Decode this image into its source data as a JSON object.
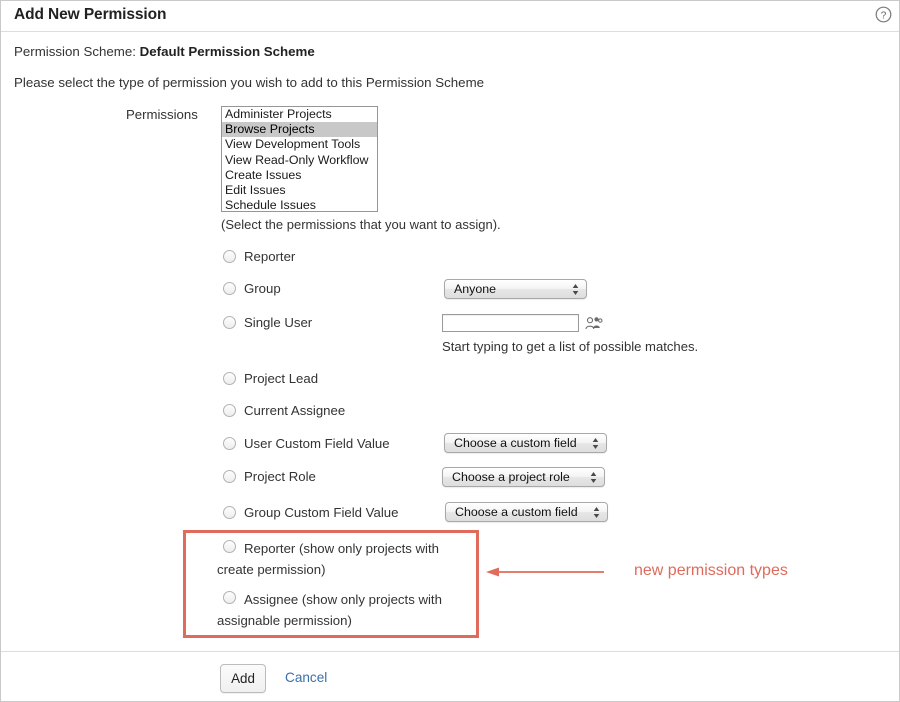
{
  "header": {
    "title": "Add New Permission",
    "help_icon": "help-circle-icon"
  },
  "intro": {
    "scheme_prefix": "Permission Scheme:",
    "scheme_name": "Default Permission Scheme",
    "instruction": "Please select the type of permission you wish to add to this Permission Scheme"
  },
  "permissions_field": {
    "label": "Permissions",
    "hint": "(Select the permissions that you want to assign).",
    "options": [
      "Administer Projects",
      "Browse Projects",
      "View Development Tools",
      "View Read-Only Workflow",
      "Create Issues",
      "Edit Issues",
      "Schedule Issues"
    ],
    "selected": "Browse Projects"
  },
  "options": [
    {
      "name": "reporter",
      "label": "Reporter"
    },
    {
      "name": "group",
      "label": "Group",
      "select_value": "Anyone"
    },
    {
      "name": "single-user",
      "label": "Single User",
      "input_value": "",
      "picker_icon": "user-picker-icon",
      "hint": "Start typing to get a list of possible matches."
    },
    {
      "name": "project-lead",
      "label": "Project Lead"
    },
    {
      "name": "current-assignee",
      "label": "Current Assignee"
    },
    {
      "name": "user-custom-field-value",
      "label": "User Custom Field Value",
      "select_value": "Choose a custom field"
    },
    {
      "name": "project-role",
      "label": "Project Role",
      "select_value": "Choose a project role"
    },
    {
      "name": "group-custom-field-value",
      "label": "Group Custom Field Value",
      "select_value": "Choose a custom field"
    },
    {
      "name": "reporter-create-permission",
      "label": "Reporter (show only projects with create permission)"
    },
    {
      "name": "assignee-assignable-permission",
      "label": "Assignee (show only projects with assignable permission)"
    }
  ],
  "annotation": {
    "text": "new permission types",
    "color": "#e06a5c"
  },
  "footer": {
    "add_label": "Add",
    "cancel_label": "Cancel"
  }
}
